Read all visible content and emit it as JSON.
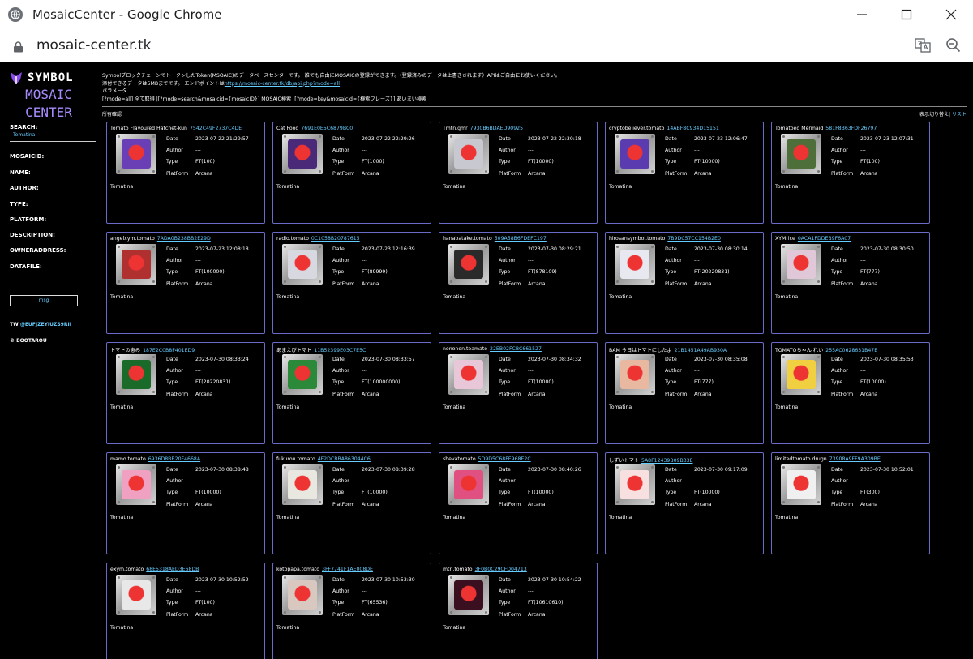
{
  "window": {
    "title": "MosaicCenter - Google Chrome",
    "url": "mosaic-center.tk"
  },
  "sidebar": {
    "logo_symbol": "SYMBOL",
    "logo_line1": "MOSAIC",
    "logo_line2": "CENTER",
    "search_label": "SEARCH:",
    "search_value": "Tomatina",
    "fields": [
      "MOSAICID:",
      "NAME:",
      "AUTHOR:",
      "TYPE:",
      "PLATFORM:",
      "DESCRIPTION:",
      "OWNERADDRESS:",
      "DATAFILE:"
    ],
    "button_label": "msg",
    "tw_label": "TW",
    "tw_handle": "@EUFJZEYIUZS9RII",
    "copyright": "© BOOTAROU"
  },
  "info": {
    "line1": "SymbolブロックチェーンでトークンしたToken(MSOAIC)のデータベースセンターです。 誰でも自由にMOSAICの登録ができます。（登録済みのデータは上書きされます）APIはご自由にお使いください。",
    "line2_prefix": "添付できるデータは5MBまでです。 エンドポイントは",
    "line2_link": "https://mosaic-center.tk/db/api.php?mode=all",
    "line3": "パラメータ",
    "line4": "[?mode=all] 全て取得 |[?mode=search&mosaicid={mosaicID}] MOSAIC検索 |[?mode=key&mosaicid={検索フレーズ}] あいまい検索",
    "owned": "所有確認",
    "toggle_prefix": "表示切り替え|",
    "toggle_link": "リスト"
  },
  "labels": {
    "date": "Date",
    "author": "Author",
    "type": "Type",
    "platform": "PlatForm"
  },
  "cards": [
    {
      "name": "Tomato Flavoured Hatchet-kun",
      "mosaic_id": "7542C49F2737C4DE",
      "date": "2023-07-22 21:29:57",
      "author": "---",
      "type": "FT(100)",
      "platform": "Arcana",
      "footer": "Tomatina",
      "art": "#6a3fb5"
    },
    {
      "name": "Cat Food",
      "mosaic_id": "7691E0E5C6879BC0",
      "date": "2023-07-22 22:29:26",
      "author": "---",
      "type": "FT(1000)",
      "platform": "Arcana",
      "footer": "Tomatina",
      "art": "#4a2a78"
    },
    {
      "name": "Tmtn.gmr",
      "mosaic_id": "7930B6BDAED90925",
      "date": "2023-07-22 22:30:18",
      "author": "---",
      "type": "FT(10000)",
      "platform": "Arcana",
      "footer": "Tomatina",
      "art": "#c8c8d0"
    },
    {
      "name": "cryptobeliever.tomato",
      "mosaic_id": "14ABF8C934D15151",
      "date": "2023-07-23 12:06:47",
      "author": "---",
      "type": "FT(10000)",
      "platform": "Arcana",
      "footer": "Tomatina",
      "art": "#5b3bb0"
    },
    {
      "name": "Tomatoed Mermaid",
      "mosaic_id": "581F8B63FDF26797",
      "date": "2023-07-23 12:07:31",
      "author": "---",
      "type": "FT(100)",
      "platform": "Arcana",
      "footer": "Tomatina",
      "art": "#4e6e3a"
    },
    {
      "name": "angelxym.tomato",
      "mosaic_id": "7ADA0B238BB2E29D",
      "date": "2023-07-23 12:08:18",
      "author": "---",
      "type": "FT(100000)",
      "platform": "Arcana",
      "footer": "Tomatina",
      "art": "#b03030"
    },
    {
      "name": "radio.tomato",
      "mosaic_id": "0C1058B20787615",
      "date": "2023-07-23 12:16:39",
      "author": "---",
      "type": "FT(89999)",
      "platform": "Arcana",
      "footer": "Tomatina",
      "art": "#d8d8e0"
    },
    {
      "name": "hanabatake.tomato",
      "mosaic_id": "509A58B6FDEFC197",
      "date": "2023-07-30 08:29:21",
      "author": "---",
      "type": "FT(878109)",
      "platform": "Arcana",
      "footer": "Tomatina",
      "art": "#2a2a2a"
    },
    {
      "name": "hirosansymbol.tomato",
      "mosaic_id": "7B9DC57CC154B2E0",
      "date": "2023-07-30 08:30:14",
      "author": "---",
      "type": "FT(20220831)",
      "platform": "Arcana",
      "footer": "Tomatina",
      "art": "#e8e8f0"
    },
    {
      "name": "XYMrice",
      "mosaic_id": "0ACA1FDDEB9F6A07",
      "date": "2023-07-30 08:30:50",
      "author": "---",
      "type": "FT(777)",
      "platform": "Arcana",
      "footer": "Tomatina",
      "art": "#e0c8d8"
    },
    {
      "name": "トマトの恵み",
      "mosaic_id": "187E2C0B8F401ED9",
      "date": "2023-07-30 08:33:24",
      "author": "---",
      "type": "FT(20220831)",
      "platform": "Arcana",
      "footer": "Tomatina",
      "art": "#1a6a2a"
    },
    {
      "name": "あまえびトマト",
      "mosaic_id": "11B52399E03C7E5C",
      "date": "2023-07-30 08:33:57",
      "author": "---",
      "type": "FT(100000000)",
      "platform": "Arcana",
      "footer": "Tomatina",
      "art": "#2a8a3a"
    },
    {
      "name": "nononon.toamato",
      "mosaic_id": "22EB02FCBC661527",
      "date": "2023-07-30 08:34:32",
      "author": "---",
      "type": "FT(10000)",
      "platform": "Arcana",
      "footer": "Tomatina",
      "art": "#e8c8d8"
    },
    {
      "name": "BAM 今日はトマトにしたよ",
      "mosaic_id": "21B1451A49AB930A",
      "date": "2023-07-30 08:35:08",
      "author": "---",
      "type": "FT(777)",
      "platform": "Arcana",
      "footer": "Tomatina",
      "art": "#e8b8a0"
    },
    {
      "name": "TOMATOちゃん れい",
      "mosaic_id": "255AC0628631B47B",
      "date": "2023-07-30 08:35:53",
      "author": "---",
      "type": "FT(10000)",
      "platform": "Arcana",
      "footer": "Tomatina",
      "art": "#f0d040"
    },
    {
      "name": "mamo.tomato",
      "mosaic_id": "6936D8BB20F4668A",
      "date": "2023-07-30 08:38:48",
      "author": "---",
      "type": "FT(10000)",
      "platform": "Arcana",
      "footer": "Tomatina",
      "art": "#f0a0c0"
    },
    {
      "name": "fukurou.tomato",
      "mosaic_id": "4F2DCBBA863044C6",
      "date": "2023-07-30 08:39:28",
      "author": "---",
      "type": "FT(10000)",
      "platform": "Arcana",
      "footer": "Tomatina",
      "art": "#e8e8e0"
    },
    {
      "name": "shevatomato",
      "mosaic_id": "5D9D5C68FE968E2C",
      "date": "2023-07-30 08:40:26",
      "author": "---",
      "type": "FT(10000)",
      "platform": "Arcana",
      "footer": "Tomatina",
      "art": "#e05080"
    },
    {
      "name": "しずいトマト",
      "mosaic_id": "5A8F12439B09B33E",
      "date": "2023-07-30 09:17:09",
      "author": "---",
      "type": "FT(10000)",
      "platform": "Arcana",
      "footer": "Tomatina",
      "art": "#f8e0e0"
    },
    {
      "name": "limitedtomato.drugn",
      "mosaic_id": "73908A9FF9A309BE",
      "date": "2023-07-30 10:52:01",
      "author": "---",
      "type": "FT(300)",
      "platform": "Arcana",
      "footer": "Tomatina",
      "art": "#f0f0f0"
    },
    {
      "name": "exym.tomato",
      "mosaic_id": "68E5318AED3E68DB",
      "date": "2023-07-30 10:52:52",
      "author": "---",
      "type": "FT(100)",
      "platform": "Arcana",
      "footer": "Tomatina",
      "art": "#e8e8e8"
    },
    {
      "name": "kotopapa.tomato",
      "mosaic_id": "3FF7741F1AE008DE",
      "date": "2023-07-30 10:53:30",
      "author": "---",
      "type": "FT(65536)",
      "platform": "Arcana",
      "footer": "Tomatina",
      "art": "#d8c8c0"
    },
    {
      "name": "mtn.tomato",
      "mosaic_id": "3F0B0C29CFD04713",
      "date": "2023-07-30 10:54:22",
      "author": "---",
      "type": "FT(10610610)",
      "platform": "Arcana",
      "footer": "Tomatina",
      "art": "#3a1020"
    }
  ]
}
